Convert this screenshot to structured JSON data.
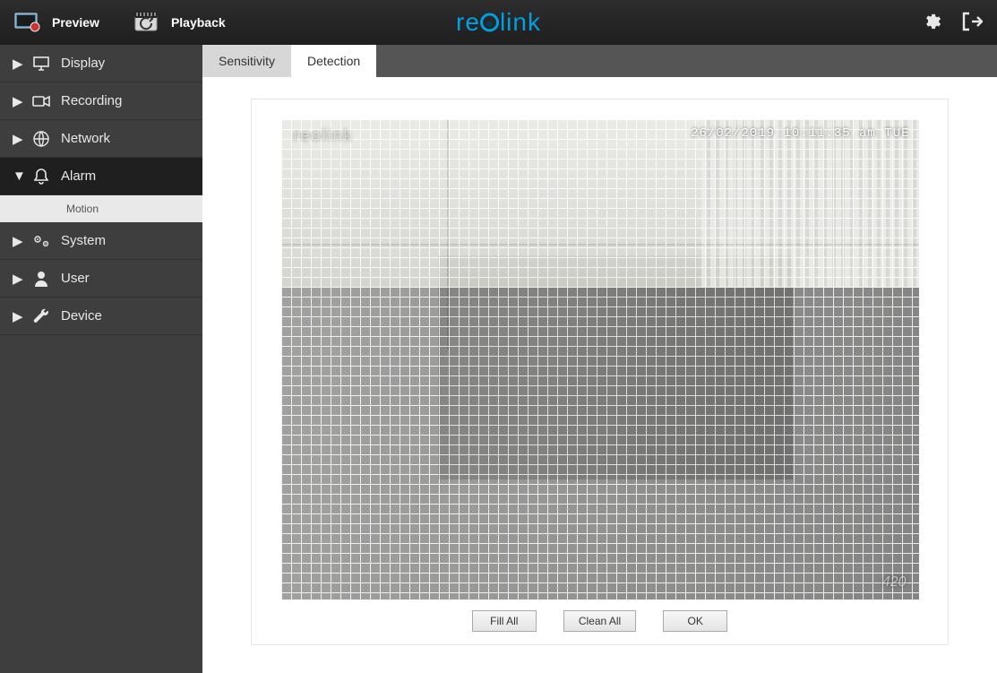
{
  "topnav": {
    "preview": "Preview",
    "playback": "Playback"
  },
  "brand": "reolink",
  "sidebar": {
    "items": [
      {
        "label": "Display",
        "icon": "monitor-icon",
        "expanded": false
      },
      {
        "label": "Recording",
        "icon": "camera-icon",
        "expanded": false
      },
      {
        "label": "Network",
        "icon": "globe-icon",
        "expanded": false
      },
      {
        "label": "Alarm",
        "icon": "bell-icon",
        "expanded": true
      },
      {
        "label": "System",
        "icon": "gears-icon",
        "expanded": false
      },
      {
        "label": "User",
        "icon": "user-icon",
        "expanded": false
      },
      {
        "label": "Device",
        "icon": "wrench-icon",
        "expanded": false
      }
    ],
    "alarm_sub": "Motion"
  },
  "tabs": {
    "sensitivity": "Sensitivity",
    "detection": "Detection"
  },
  "osd": {
    "timestamp": "26/02/2019 10:11:35 am TUE",
    "watermark": "reolink",
    "bitrate": "420"
  },
  "buttons": {
    "fill_all": "Fill All",
    "clean_all": "Clean All",
    "ok": "OK"
  }
}
